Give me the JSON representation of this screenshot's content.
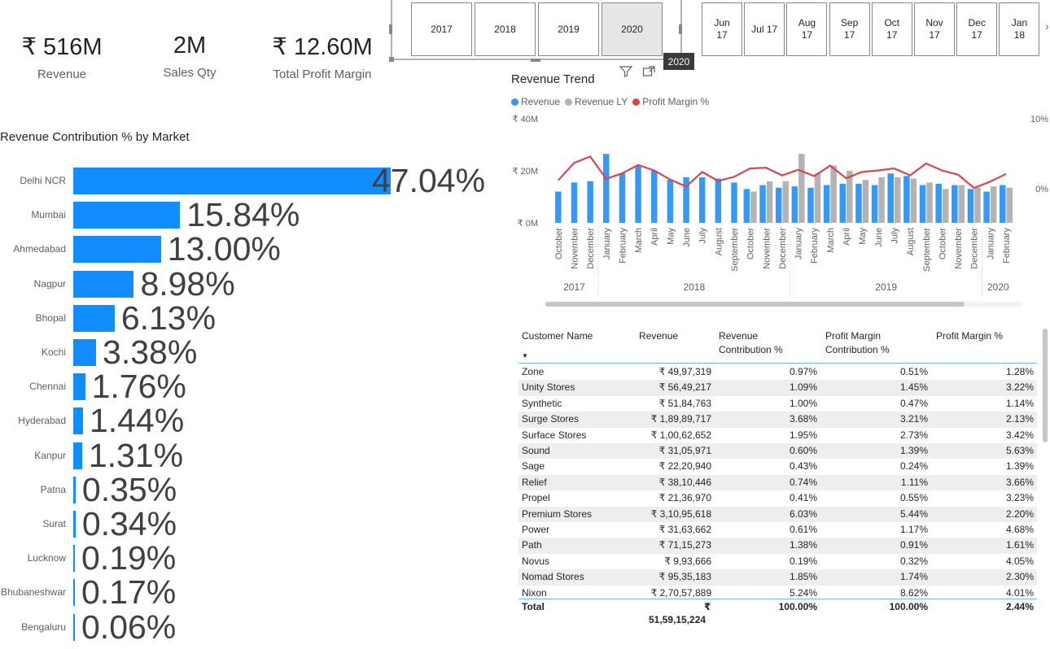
{
  "kpis": [
    {
      "value": "₹ 516M",
      "label": "Revenue"
    },
    {
      "value": "2M",
      "label": "Sales Qty"
    },
    {
      "value": "₹ 12.60M",
      "label": "Total Profit Margin"
    }
  ],
  "year_slicer": {
    "years": [
      "2017",
      "2018",
      "2019",
      "2020"
    ],
    "selected": "2020",
    "tooltip": "2020"
  },
  "month_slicer": {
    "months": [
      {
        "m": "Jun",
        "y": "17"
      },
      {
        "m": "Jul 17",
        "y": ""
      },
      {
        "m": "Aug",
        "y": "17"
      },
      {
        "m": "Sep",
        "y": "17"
      },
      {
        "m": "Oct",
        "y": "17"
      },
      {
        "m": "Nov",
        "y": "17"
      },
      {
        "m": "Dec",
        "y": "17"
      },
      {
        "m": "Jan",
        "y": "18"
      }
    ]
  },
  "market_chart": {
    "title": "Revenue Contribution % by Market",
    "color": "#118dff",
    "chart_data": {
      "type": "bar",
      "categories": [
        "Delhi NCR",
        "Mumbai",
        "Ahmedabad",
        "Nagpur",
        "Bhopal",
        "Kochi",
        "Chennai",
        "Hyderabad",
        "Kanpur",
        "Patna",
        "Surat",
        "Lucknow",
        "Bhubaneshwar",
        "Bengaluru"
      ],
      "values": [
        47.04,
        15.84,
        13.0,
        8.98,
        6.13,
        3.38,
        1.76,
        1.44,
        1.31,
        0.35,
        0.34,
        0.19,
        0.17,
        0.06
      ],
      "labels": [
        "47.04%",
        "15.84%",
        "13.00%",
        "8.98%",
        "6.13%",
        "3.38%",
        "1.76%",
        "1.44%",
        "1.31%",
        "0.35%",
        "0.34%",
        "0.19%",
        "0.17%",
        "0.06%"
      ]
    }
  },
  "trend_chart": {
    "title": "Revenue Trend",
    "legend": [
      {
        "name": "Revenue",
        "color": "#3599f5"
      },
      {
        "name": "Revenue LY",
        "color": "#b3b3b3"
      },
      {
        "name": "Profit Margin %",
        "color": "#d64550"
      }
    ],
    "chart_data": {
      "type": "bar",
      "categories": [
        "October",
        "November",
        "December",
        "January",
        "February",
        "March",
        "April",
        "May",
        "June",
        "July",
        "August",
        "September",
        "October",
        "November",
        "December",
        "January",
        "February",
        "March",
        "April",
        "May",
        "June",
        "July",
        "August",
        "September",
        "October",
        "November",
        "December",
        "January",
        "February"
      ],
      "year_groups": [
        {
          "label": "2017",
          "start": 0,
          "end": 2
        },
        {
          "label": "2018",
          "start": 3,
          "end": 14
        },
        {
          "label": "2019",
          "start": 15,
          "end": 26
        },
        {
          "label": "2020",
          "start": 27,
          "end": 28
        }
      ],
      "series": [
        {
          "name": "Revenue",
          "values": [
            12,
            15.5,
            16,
            26.5,
            19,
            22,
            20,
            16.5,
            17.5,
            17.5,
            17,
            15.5,
            13,
            14.5,
            13.5,
            14,
            13.5,
            14.5,
            15,
            15,
            14.5,
            19,
            18,
            14.5,
            15,
            14.5,
            13,
            12,
            14.5
          ]
        },
        {
          "name": "Revenue LY",
          "values": [
            null,
            null,
            null,
            null,
            null,
            null,
            null,
            null,
            null,
            null,
            null,
            null,
            12,
            16,
            16,
            26.5,
            19,
            22,
            20,
            16.5,
            17.5,
            17.5,
            17,
            15.5,
            13,
            14.5,
            13.5,
            14,
            13.5
          ]
        },
        {
          "name": "Profit Margin %",
          "values": [
            1.2,
            3.7,
            4.6,
            1.4,
            2.2,
            3.4,
            2.6,
            1.3,
            0.3,
            2.4,
            1.1,
            1.7,
            2.9,
            3.0,
            1.9,
            2.7,
            1.8,
            3.3,
            1.5,
            2.4,
            2.6,
            2.9,
            1.9,
            3.6,
            2.6,
            2.0,
            0.1,
            1.0,
            2.1
          ]
        }
      ],
      "y_left_ticks": [
        "₹ 0M",
        "₹ 20M",
        "₹ 40M"
      ],
      "y_right_ticks": [
        "0%",
        "10%"
      ],
      "ylim_left": [
        0,
        40
      ],
      "ylim_right": [
        -5,
        10
      ]
    }
  },
  "table": {
    "columns": [
      "Customer Name",
      "Revenue",
      "Revenue Contribution %",
      "Profit Margin Contribution %",
      "Profit Margin %"
    ],
    "col_head_lines": [
      [
        "Customer Name"
      ],
      [
        "Revenue"
      ],
      [
        "Revenue",
        "Contribution %"
      ],
      [
        "Profit Margin",
        "Contribution %"
      ],
      [
        "Profit Margin %"
      ]
    ],
    "rows": [
      [
        "Zone",
        "₹ 49,97,319",
        "0.97%",
        "0.51%",
        "1.28%"
      ],
      [
        "Unity Stores",
        "₹ 56,49,217",
        "1.09%",
        "1.45%",
        "3.22%"
      ],
      [
        "Synthetic",
        "₹ 51,84,763",
        "1.00%",
        "0.47%",
        "1.14%"
      ],
      [
        "Surge Stores",
        "₹ 1,89,89,717",
        "3.68%",
        "3.21%",
        "2.13%"
      ],
      [
        "Surface Stores",
        "₹ 1,00,62,652",
        "1.95%",
        "2.73%",
        "3.42%"
      ],
      [
        "Sound",
        "₹ 31,05,971",
        "0.60%",
        "1.39%",
        "5.63%"
      ],
      [
        "Sage",
        "₹ 22,20,940",
        "0.43%",
        "0.24%",
        "1.39%"
      ],
      [
        "Relief",
        "₹ 38,10,446",
        "0.74%",
        "1.11%",
        "3.66%"
      ],
      [
        "Propel",
        "₹ 21,36,970",
        "0.41%",
        "0.55%",
        "3.23%"
      ],
      [
        "Premium Stores",
        "₹ 3,10,95,618",
        "6.03%",
        "5.44%",
        "2.20%"
      ],
      [
        "Power",
        "₹ 31,63,662",
        "0.61%",
        "1.17%",
        "4.68%"
      ],
      [
        "Path",
        "₹ 71,15,273",
        "1.38%",
        "0.91%",
        "1.61%"
      ],
      [
        "Novus",
        "₹ 9,93,666",
        "0.19%",
        "0.32%",
        "4.05%"
      ],
      [
        "Nomad Stores",
        "₹ 95,35,183",
        "1.85%",
        "1.74%",
        "2.30%"
      ],
      [
        "Nixon",
        "₹ 2,70,57,889",
        "5.24%",
        "8.62%",
        "4.01%"
      ]
    ],
    "total": {
      "label": "Total",
      "currency": "₹",
      "revenue": "51,59,15,224",
      "rc": "100.00%",
      "pmc": "100.00%",
      "pm": "2.44%"
    }
  },
  "icons": [
    "filter-icon",
    "focus-mode-icon",
    "more-options-icon",
    "sort-desc-icon",
    "slicer-scroll-icon"
  ]
}
